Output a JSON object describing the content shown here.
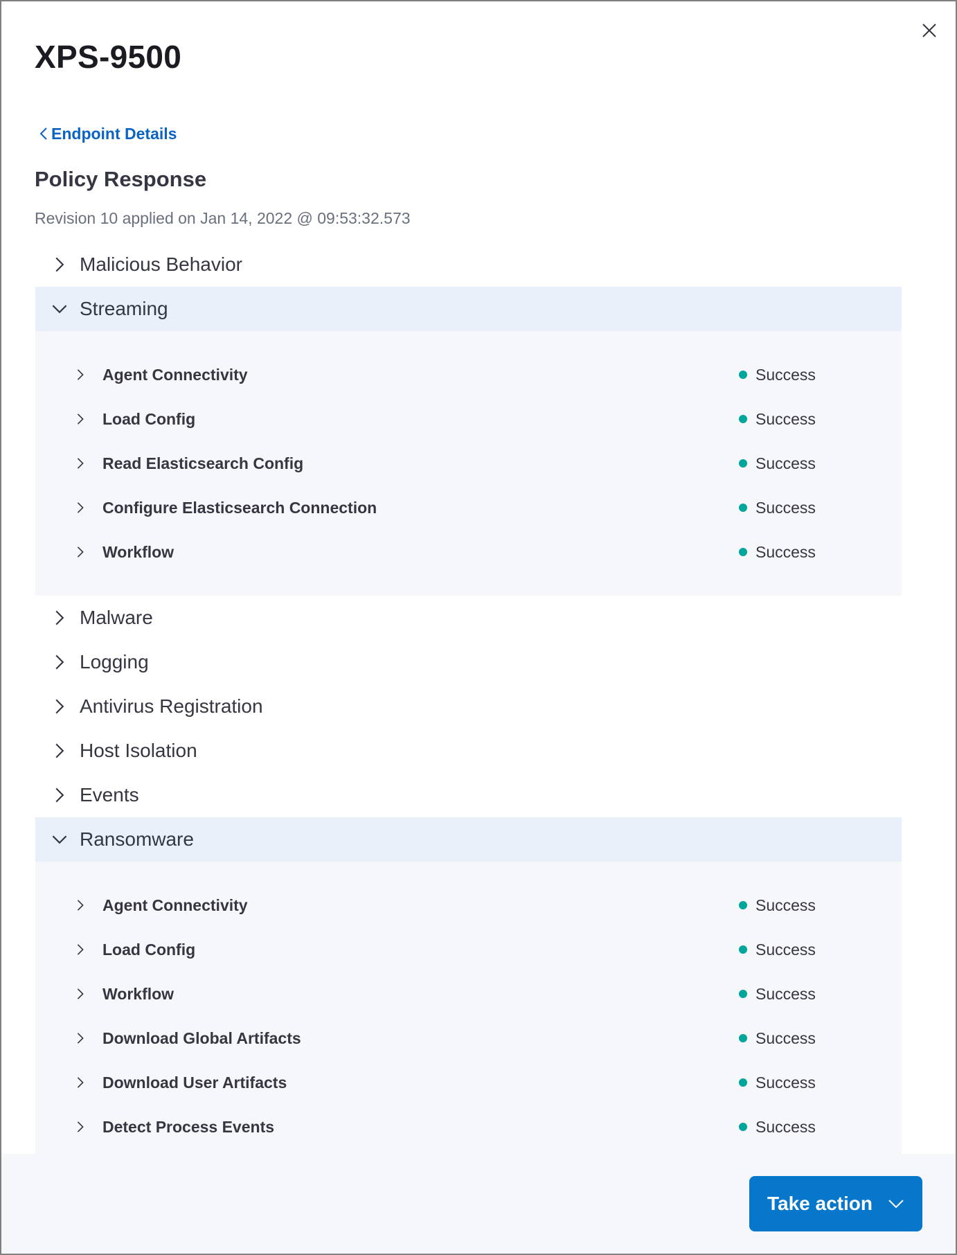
{
  "flyout": {
    "title": "XPS-9500",
    "close_icon": "close-icon",
    "back_link_label": "Endpoint Details",
    "section_title": "Policy Response",
    "revision_text": "Revision 10 applied on Jan 14, 2022 @ 09:53:32.573"
  },
  "policy_tree": [
    {
      "label": "Malicious Behavior",
      "expanded": false,
      "children": []
    },
    {
      "label": "Streaming",
      "expanded": true,
      "children": [
        {
          "label": "Agent Connectivity",
          "status": "Success"
        },
        {
          "label": "Load Config",
          "status": "Success"
        },
        {
          "label": "Read Elasticsearch Config",
          "status": "Success"
        },
        {
          "label": "Configure Elasticsearch Connection",
          "status": "Success"
        },
        {
          "label": "Workflow",
          "status": "Success"
        }
      ]
    },
    {
      "label": "Malware",
      "expanded": false,
      "children": []
    },
    {
      "label": "Logging",
      "expanded": false,
      "children": []
    },
    {
      "label": "Antivirus Registration",
      "expanded": false,
      "children": []
    },
    {
      "label": "Host Isolation",
      "expanded": false,
      "children": []
    },
    {
      "label": "Events",
      "expanded": false,
      "children": []
    },
    {
      "label": "Ransomware",
      "expanded": true,
      "children": [
        {
          "label": "Agent Connectivity",
          "status": "Success"
        },
        {
          "label": "Load Config",
          "status": "Success"
        },
        {
          "label": "Workflow",
          "status": "Success"
        },
        {
          "label": "Download Global Artifacts",
          "status": "Success"
        },
        {
          "label": "Download User Artifacts",
          "status": "Success"
        },
        {
          "label": "Detect Process Events",
          "status": "Success"
        }
      ]
    }
  ],
  "footer": {
    "take_action_label": "Take action"
  },
  "colors": {
    "link": "#0b64c4",
    "success_dot": "#00a69b",
    "expanded_header_bg": "#e9f0f9",
    "expanded_body_bg": "#f5f7fb",
    "primary_button": "#0777cc"
  }
}
